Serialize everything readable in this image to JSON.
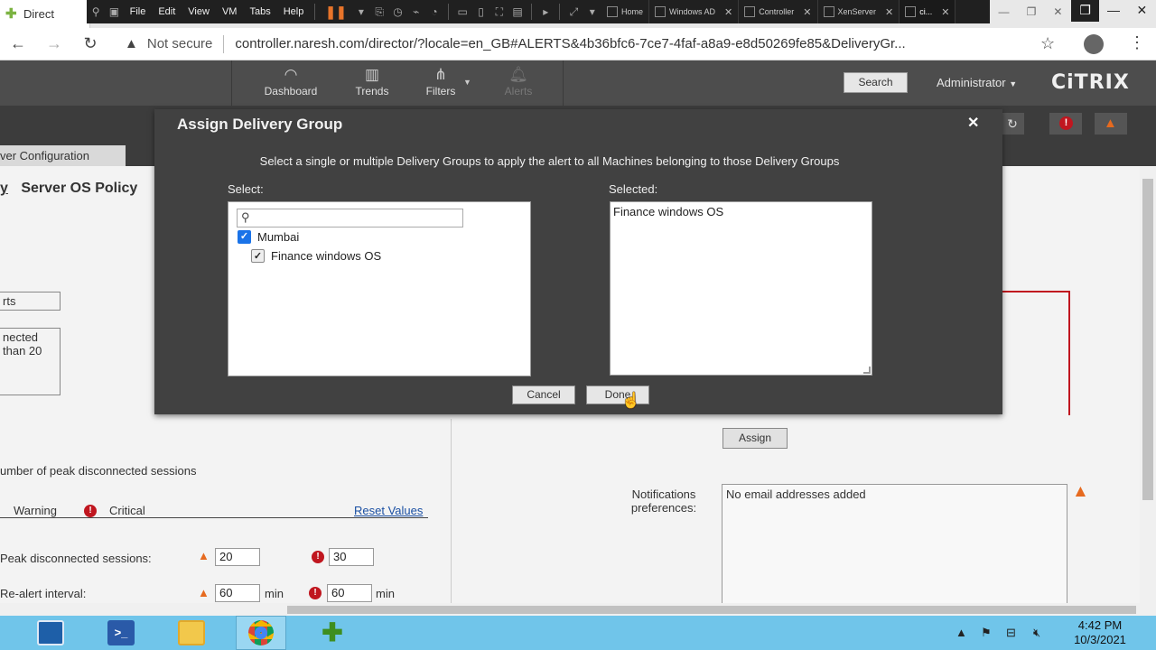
{
  "browser": {
    "first_tab_title": "Direct",
    "vm_menu": [
      "File",
      "Edit",
      "View",
      "VM",
      "Tabs",
      "Help"
    ],
    "vm_tabs": [
      {
        "label": "Home"
      },
      {
        "label": "Windows AD"
      },
      {
        "label": "Controller"
      },
      {
        "label": "XenServer"
      },
      {
        "label": "ci..."
      }
    ],
    "security_label": "Not secure",
    "url": "controller.naresh.com/director/?locale=en_GB#ALERTS&4b36bfc6-7ce7-4faf-a8a9-e8d50269fe85&DeliveryGr..."
  },
  "director": {
    "nav": [
      {
        "label": "Dashboard",
        "icon": "dashboard-icon"
      },
      {
        "label": "Trends",
        "icon": "trends-icon"
      },
      {
        "label": "Filters",
        "icon": "filters-icon"
      },
      {
        "label": "Alerts",
        "icon": "bell-icon"
      }
    ],
    "search_label": "Search",
    "admin_label": "Administrator",
    "logo_text": "CiTRIX",
    "config_tab": "ver Configuration"
  },
  "page": {
    "crumb_left": "y",
    "crumb_right": "Server OS Policy",
    "box1": "rts",
    "box2_line1": "nected",
    "box2_line2": "than 20",
    "peak_title": "umber of peak disconnected sessions",
    "legend_warning": "Warning",
    "legend_critical": "Critical",
    "reset_values": "Reset Values",
    "row1_label": "Peak disconnected sessions:",
    "row1_warning": "20",
    "row1_critical": "30",
    "row2_label": "Re-alert interval:",
    "row2_warning": "60",
    "row2_critical": "60",
    "unit_min": "min",
    "assign_label": "Assign",
    "notif_label": "Notifications preferences:",
    "notif_value": "No email addresses added"
  },
  "modal": {
    "title": "Assign Delivery Group",
    "description": "Select a single or multiple Delivery Groups to apply the alert to all Machines belonging to those Delivery Groups",
    "select_label": "Select:",
    "selected_label": "Selected:",
    "search_placeholder": "",
    "tree": [
      {
        "label": "Mumbai",
        "checked": true
      },
      {
        "label": "Finance windows OS",
        "checked": true
      }
    ],
    "selected_items": "Finance windows OS",
    "cancel_label": "Cancel",
    "done_label": "Done"
  },
  "taskbar": {
    "time": "4:42 PM",
    "date": "10/3/2021"
  },
  "colors": {
    "header": "#4d4d4d",
    "modal_bg": "#414141",
    "critical": "#c0161f",
    "warning": "#e66a1f",
    "taskbar": "#70c5ea"
  }
}
